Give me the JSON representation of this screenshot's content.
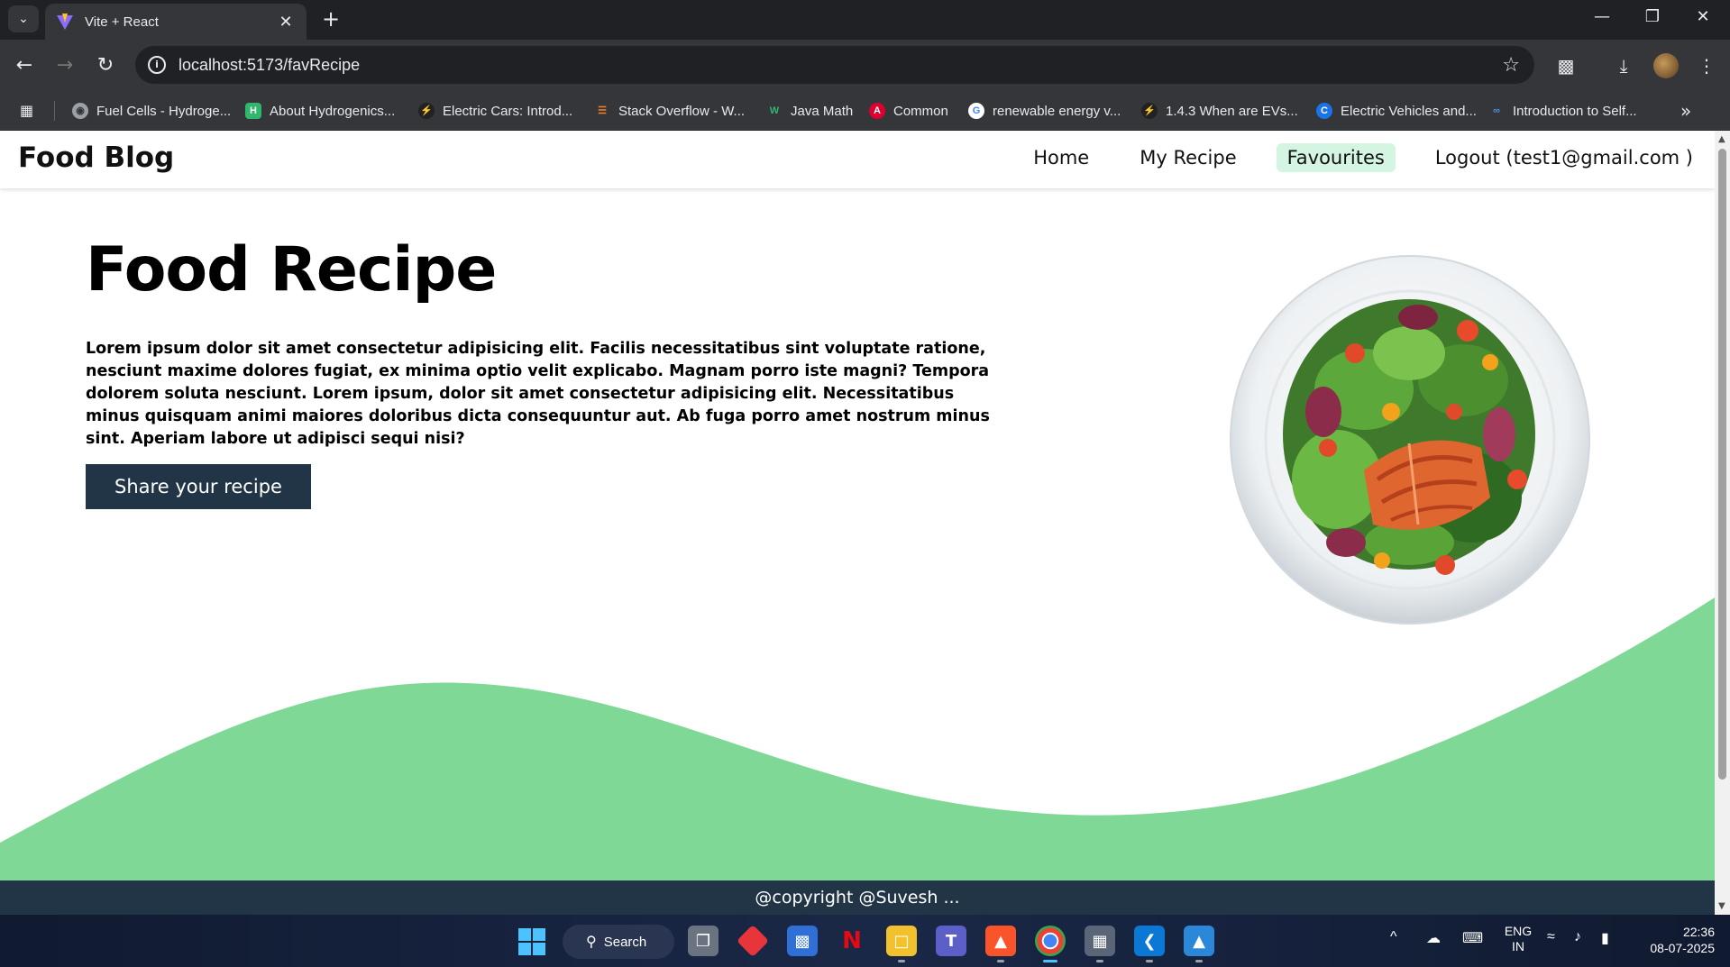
{
  "browser": {
    "tab_title": "Vite + React",
    "url": "localhost:5173/favRecipe",
    "bookmarks": [
      {
        "label": "Fuel Cells - Hydroge...",
        "icon": "globe-icon"
      },
      {
        "label": "About Hydrogenics...",
        "icon": "hydrogenics-icon"
      },
      {
        "label": "Electric Cars: Introd...",
        "icon": "bolt-icon"
      },
      {
        "label": "Stack Overflow - W...",
        "icon": "stackoverflow-icon"
      },
      {
        "label": "Java Math",
        "icon": "w-icon"
      },
      {
        "label": "Common",
        "icon": "angular-icon"
      },
      {
        "label": "renewable energy v...",
        "icon": "google-icon"
      },
      {
        "label": "1.4.3 When are EVs...",
        "icon": "bolt-icon"
      },
      {
        "label": "Electric Vehicles and...",
        "icon": "c-icon"
      },
      {
        "label": "Introduction to Self...",
        "icon": "link-icon"
      }
    ]
  },
  "site": {
    "brand": "Food Blog",
    "nav": [
      {
        "label": "Home",
        "active": false
      },
      {
        "label": "My Recipe",
        "active": false
      },
      {
        "label": "Favourites",
        "active": true
      },
      {
        "label": "Logout (test1@gmail.com )",
        "active": false
      }
    ],
    "hero": {
      "title": "Food Recipe",
      "text": "Lorem ipsum dolor sit amet consectetur adipisicing elit. Facilis necessitatibus sint voluptate ratione, nesciunt maxime dolores fugiat, ex minima optio velit explicabo. Magnam porro iste magni? Tempora dolorem soluta nesciunt. Lorem ipsum, dolor sit amet consectetur adipisicing elit. Necessitatibus minus quisquam animi maiores doloribus dicta consequuntur aut. Ab fuga porro amet nostrum minus sint. Aperiam labore ut adipisci sequi nisi?",
      "button": "Share your recipe"
    },
    "footer": "@copyright @Suvesh ..."
  },
  "colors": {
    "wave": "#7fd895",
    "footer": "#213547",
    "button": "#213547",
    "active_nav": "#d5f5e3"
  },
  "taskbar": {
    "search_label": "Search",
    "lang_top": "ENG",
    "lang_bottom": "IN",
    "time": "22:36",
    "date": "08-07-2025"
  }
}
